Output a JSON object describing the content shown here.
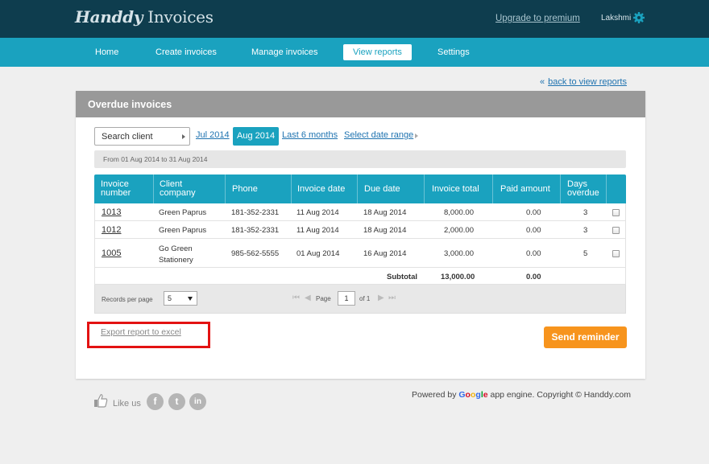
{
  "header": {
    "logo_script": "Handdy",
    "logo_light": "Invoices",
    "upgrade_label": "Upgrade to premium",
    "user_name": "Lakshmi"
  },
  "nav": {
    "items": [
      {
        "label": "Home"
      },
      {
        "label": "Create invoices"
      },
      {
        "label": "Manage invoices"
      },
      {
        "label": "View reports",
        "active": true
      },
      {
        "label": "Settings"
      }
    ]
  },
  "back_link": {
    "arrow": "«",
    "label": "back to view reports"
  },
  "report": {
    "title": "Overdue invoices",
    "search_placeholder": "Search client",
    "periods": {
      "jul": "Jul 2014",
      "aug": "Aug 2014",
      "last6": "Last 6 months",
      "range": "Select date range"
    },
    "date_range_text": "From 01 Aug 2014 to 31 Aug 2014",
    "columns": {
      "invoice_number": [
        "Invoice",
        "number"
      ],
      "client_company": [
        "Client",
        "company"
      ],
      "phone": "Phone",
      "invoice_date": "Invoice date",
      "due_date": "Due date",
      "invoice_total": "Invoice total",
      "paid_amount": "Paid amount",
      "days_overdue": [
        "Days",
        "overdue"
      ]
    },
    "rows": [
      {
        "invoice": "1013",
        "client": [
          "Green Paprus"
        ],
        "phone": "181-352-2331",
        "invoice_date": "11 Aug 2014",
        "due_date": "18 Aug 2014",
        "total": "8,000.00",
        "paid": "0.00",
        "days": "3"
      },
      {
        "invoice": "1012",
        "client": [
          "Green Paprus"
        ],
        "phone": "181-352-2331",
        "invoice_date": "11 Aug 2014",
        "due_date": "18 Aug 2014",
        "total": "2,000.00",
        "paid": "0.00",
        "days": "3"
      },
      {
        "invoice": "1005",
        "client": [
          "Go Green",
          "Stationery"
        ],
        "phone": "985-562-5555",
        "invoice_date": "01 Aug 2014",
        "due_date": "16 Aug 2014",
        "total": "3,000.00",
        "paid": "0.00",
        "days": "5"
      }
    ],
    "subtotal": {
      "label": "Subtotal",
      "total": "13,000.00",
      "paid": "0.00"
    },
    "pager": {
      "records_label": "Records per page",
      "records_value": "5",
      "page_label": "Page",
      "page_value": "1",
      "of_label": "of 1"
    },
    "export_label": "Export report to excel",
    "send_label": "Send reminder"
  },
  "footer": {
    "like_label": "Like us",
    "social": [
      "f",
      "t",
      "in"
    ],
    "powered_prefix": "Powered by",
    "google": [
      "G",
      "o",
      "o",
      "g",
      "l",
      "e"
    ],
    "powered_suffix": "app engine. Copyright © Handdy.com"
  },
  "colors": {
    "topbar": "#0e3d4e",
    "navbar": "#1aa2bf",
    "accent": "#1aa2bf",
    "send_button": "#f7941d",
    "highlight": "#e31212"
  }
}
